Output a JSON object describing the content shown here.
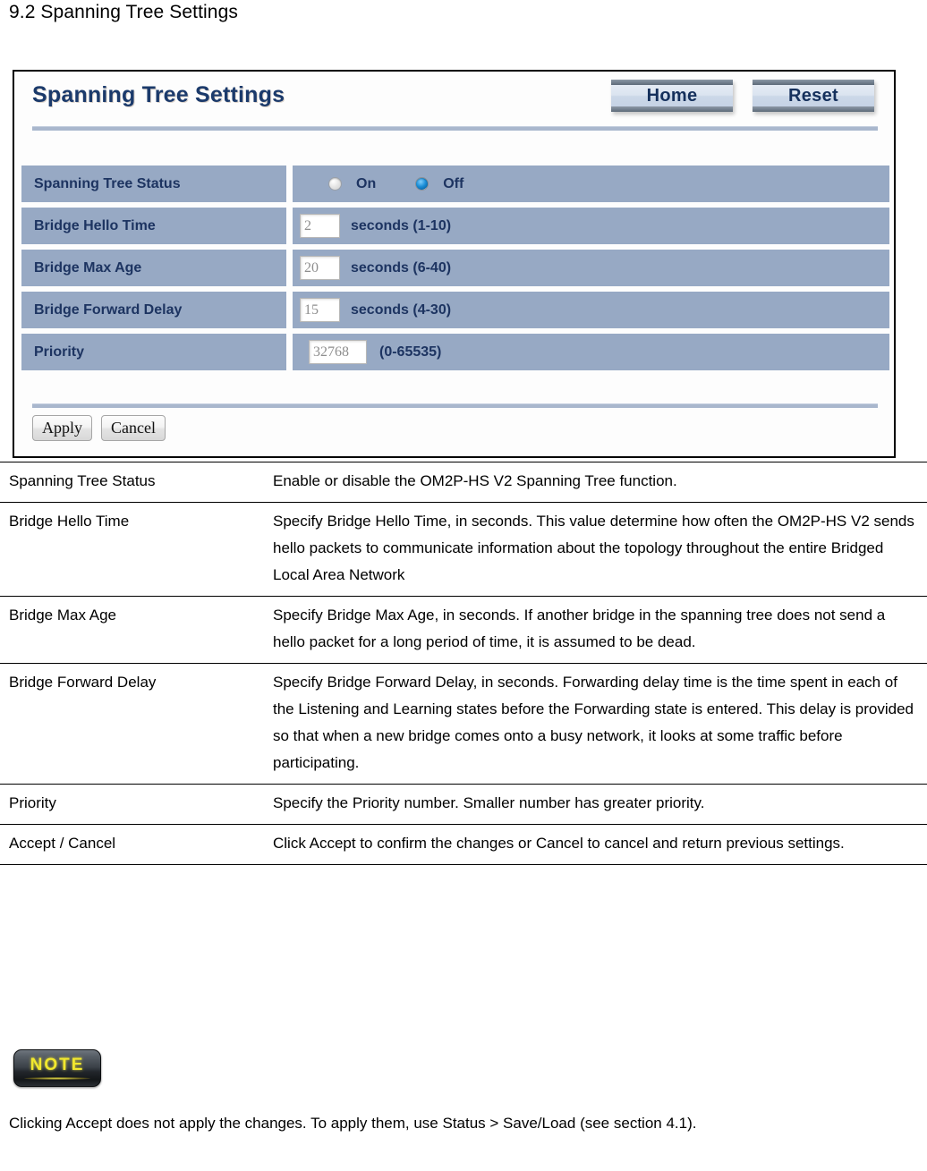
{
  "heading": "9.2 Spanning Tree Settings",
  "panel": {
    "title": "Spanning Tree Settings",
    "nav_buttons": [
      {
        "label": "Home"
      },
      {
        "label": "Reset"
      }
    ],
    "rows": [
      {
        "label": "Spanning Tree Status",
        "control": "radio",
        "options": [
          {
            "label": "On",
            "checked": false
          },
          {
            "label": "Off",
            "checked": true
          }
        ]
      },
      {
        "label": "Bridge Hello Time",
        "control": "input",
        "value": "2",
        "suffix": "seconds (1-10)"
      },
      {
        "label": "Bridge Max Age",
        "control": "input",
        "value": "20",
        "suffix": "seconds (6-40)"
      },
      {
        "label": "Bridge Forward Delay",
        "control": "input",
        "value": "15",
        "suffix": "seconds (4-30)"
      },
      {
        "label": "Priority",
        "control": "input-wide",
        "value": "32768",
        "suffix": "(0-65535)"
      }
    ],
    "actions": [
      {
        "label": "Apply"
      },
      {
        "label": "Cancel"
      }
    ]
  },
  "descriptions": [
    {
      "term": "Spanning Tree Status",
      "desc": "Enable or disable the OM2P-HS V2 Spanning Tree function."
    },
    {
      "term": "Bridge Hello Time",
      "desc": "Specify Bridge Hello Time, in seconds. This value determine how often the OM2P-HS V2 sends hello packets to communicate information about the topology throughout the entire Bridged Local Area Network"
    },
    {
      "term": "Bridge Max Age",
      "desc": "Specify Bridge Max Age, in seconds. If another bridge in the spanning tree does not send a hello packet for a long period of time, it is assumed to be dead."
    },
    {
      "term": "Bridge Forward Delay",
      "desc": "Specify Bridge Forward Delay, in seconds. Forwarding delay time is the time spent in each of the Listening and Learning states before the Forwarding state is entered. This delay is provided so that when a new bridge comes onto a busy network, it looks at some traffic before participating."
    },
    {
      "term": "Priority",
      "desc": "Specify the Priority number. Smaller number has greater priority."
    },
    {
      "term": "Accept / Cancel",
      "desc": "Click Accept to confirm the changes or Cancel to cancel and return previous settings."
    }
  ],
  "note": {
    "badge": "NOTE",
    "body": "Clicking Accept does not apply the changes. To apply them, use Status > Save/Load (see section 4.1)."
  },
  "colors": {
    "row_bg": "#97a9c4",
    "row_text": "#1d3461",
    "panel_title": "#1b3a6b",
    "divider": "#a9b7cd",
    "radio_checked": "#1c8fd8",
    "note_text": "#f2e82e"
  }
}
